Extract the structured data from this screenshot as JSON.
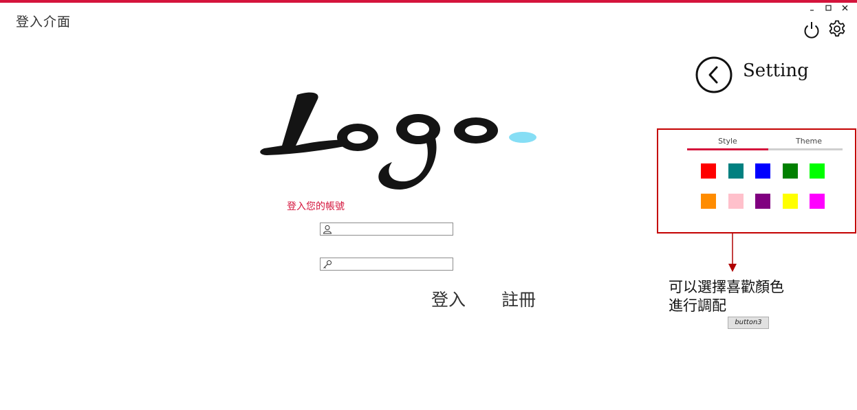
{
  "window": {
    "title": "登入介面",
    "controls": [
      "minimize",
      "maximize",
      "close"
    ]
  },
  "toolbar": {
    "icons": [
      "power-icon",
      "gear-icon"
    ]
  },
  "settings": {
    "title": "Setting",
    "back_icon": "chevron-left-circle-icon"
  },
  "logo": {
    "text": "Logo",
    "dot_color": "#86def5"
  },
  "login": {
    "prompt": "登入您的帳號",
    "username": {
      "value": "",
      "placeholder": "",
      "icon": "user-icon"
    },
    "password": {
      "value": "",
      "placeholder": "",
      "icon": "key-icon"
    },
    "login_label": "登入",
    "register_label": "註冊"
  },
  "theme_panel": {
    "tabs": [
      {
        "label": "Style",
        "active": true
      },
      {
        "label": "Theme",
        "active": false
      }
    ],
    "swatches": [
      [
        "#ff0000",
        "#008080",
        "#0000ff",
        "#008000",
        "#00ff00"
      ],
      [
        "#ff8c00",
        "#ffc0cb",
        "#800080",
        "#ffff00",
        "#ff00ff"
      ]
    ]
  },
  "annotation": {
    "line1": "可以選擇喜歡顏色",
    "line2": "進行調配"
  },
  "button3": {
    "label": "button3"
  },
  "colors": {
    "accent": "#d4143c",
    "panel_border": "#c40000"
  }
}
